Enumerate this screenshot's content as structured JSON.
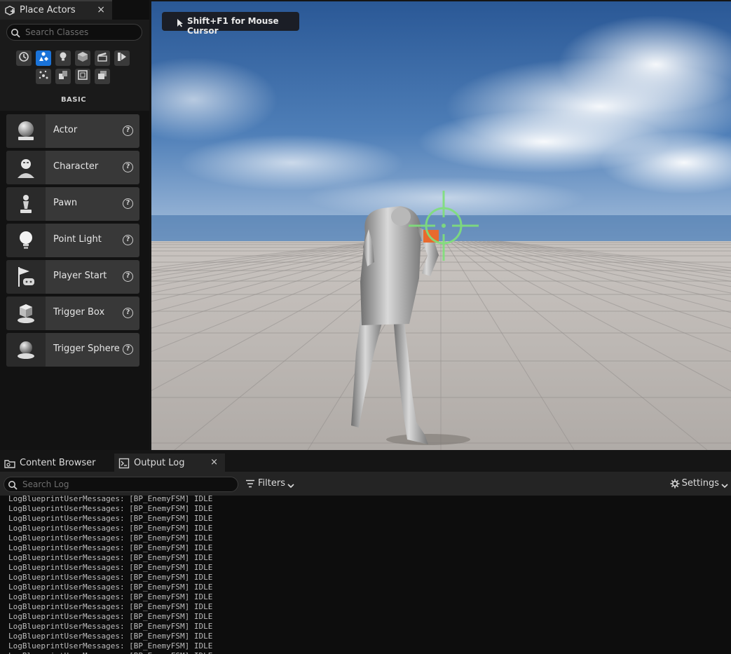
{
  "place_actors": {
    "tab_title": "Place Actors",
    "tab_close": "×",
    "search_placeholder": "Search Classes",
    "categories": [
      {
        "icon": "recent-icon",
        "active": false
      },
      {
        "icon": "basic-shapes-icon",
        "active": true
      },
      {
        "icon": "light-icon",
        "active": false
      },
      {
        "icon": "cube-icon",
        "active": false
      },
      {
        "icon": "cinematic-icon",
        "active": false
      },
      {
        "icon": "visual-effects-icon",
        "active": false
      },
      {
        "icon": "particles-icon",
        "active": false
      },
      {
        "icon": "geometry-icon",
        "active": false
      },
      {
        "icon": "volumes-icon",
        "active": false
      },
      {
        "icon": "all-classes-icon",
        "active": false
      }
    ],
    "category_label": "BASIC",
    "items": [
      {
        "label": "Actor",
        "icon": "actor-sphere-icon"
      },
      {
        "label": "Character",
        "icon": "character-icon"
      },
      {
        "label": "Pawn",
        "icon": "pawn-icon"
      },
      {
        "label": "Point Light",
        "icon": "point-light-icon"
      },
      {
        "label": "Player Start",
        "icon": "player-start-icon"
      },
      {
        "label": "Trigger Box",
        "icon": "trigger-box-icon"
      },
      {
        "label": "Trigger Sphere",
        "icon": "trigger-sphere-icon"
      }
    ],
    "help_glyph": "?"
  },
  "viewport": {
    "cursor_hint": "Shift+F1 for Mouse Cursor",
    "colors": {
      "sky_top": "#2f5c9a",
      "sky_horizon": "#9db7d6",
      "floor_light": "#bdb8b5",
      "floor_dark": "#a7a29f",
      "crosshair": "#7fe07a"
    }
  },
  "bottom": {
    "tabs": [
      {
        "label": "Content Browser",
        "icon": "content-browser-icon"
      },
      {
        "label": "Output Log",
        "icon": "output-log-icon",
        "close": "×"
      }
    ],
    "search_placeholder": "Search Log",
    "filters_label": "Filters",
    "settings_label": "Settings",
    "log_lines": [
      "LogBlueprintUserMessages: [BP_EnemyFSM] IDLE",
      "LogBlueprintUserMessages: [BP_EnemyFSM] IDLE",
      "LogBlueprintUserMessages: [BP_EnemyFSM] IDLE",
      "LogBlueprintUserMessages: [BP_EnemyFSM] IDLE",
      "LogBlueprintUserMessages: [BP_EnemyFSM] IDLE",
      "LogBlueprintUserMessages: [BP_EnemyFSM] IDLE",
      "LogBlueprintUserMessages: [BP_EnemyFSM] IDLE",
      "LogBlueprintUserMessages: [BP_EnemyFSM] IDLE",
      "LogBlueprintUserMessages: [BP_EnemyFSM] IDLE",
      "LogBlueprintUserMessages: [BP_EnemyFSM] IDLE",
      "LogBlueprintUserMessages: [BP_EnemyFSM] IDLE",
      "LogBlueprintUserMessages: [BP_EnemyFSM] IDLE",
      "LogBlueprintUserMessages: [BP_EnemyFSM] IDLE",
      "LogBlueprintUserMessages: [BP_EnemyFSM] IDLE",
      "LogBlueprintUserMessages: [BP_EnemyFSM] IDLE",
      "LogBlueprintUserMessages: [BP_EnemyFSM] IDLE",
      "LogBlueprintUserMessages: [BP_EnemyFSM] IDLE"
    ]
  }
}
